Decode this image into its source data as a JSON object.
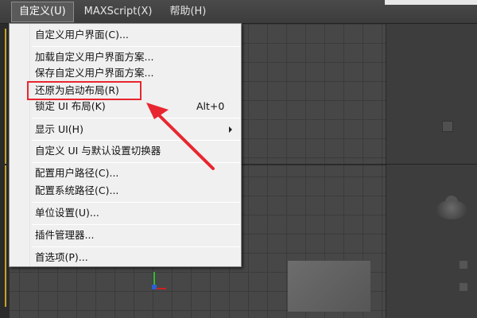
{
  "menubar": {
    "items": [
      {
        "label": "自定义(U)",
        "active": true
      },
      {
        "label": "MAXScript(X)",
        "active": false
      },
      {
        "label": "帮助(H)",
        "active": false
      }
    ]
  },
  "dropdown": {
    "items": [
      {
        "label": "自定义用户界面(C)..."
      },
      {
        "label": "加载自定义用户界面方案..."
      },
      {
        "label": "保存自定义用户界面方案..."
      },
      {
        "label": "还原为启动布局(R)",
        "highlighted": true
      },
      {
        "label": "锁定 UI 布局(K)",
        "shortcut": "Alt+0"
      },
      {
        "label": "显示 UI(H)",
        "submenu": true
      },
      {
        "label": "自定义 UI 与默认设置切换器"
      },
      {
        "label": "配置用户路径(C)..."
      },
      {
        "label": "配置系统路径(C)..."
      },
      {
        "label": "单位设置(U)..."
      },
      {
        "label": "插件管理器..."
      },
      {
        "label": "首选项(P)..."
      }
    ]
  },
  "annotation": {
    "color": "#e8262f",
    "target": "还原为启动布局(R)"
  },
  "colors": {
    "menubar_bg": "#3c3c3c",
    "menu_bg": "#f0f0f0",
    "viewport_bg": "#474747",
    "highlight": "#e8262f"
  }
}
